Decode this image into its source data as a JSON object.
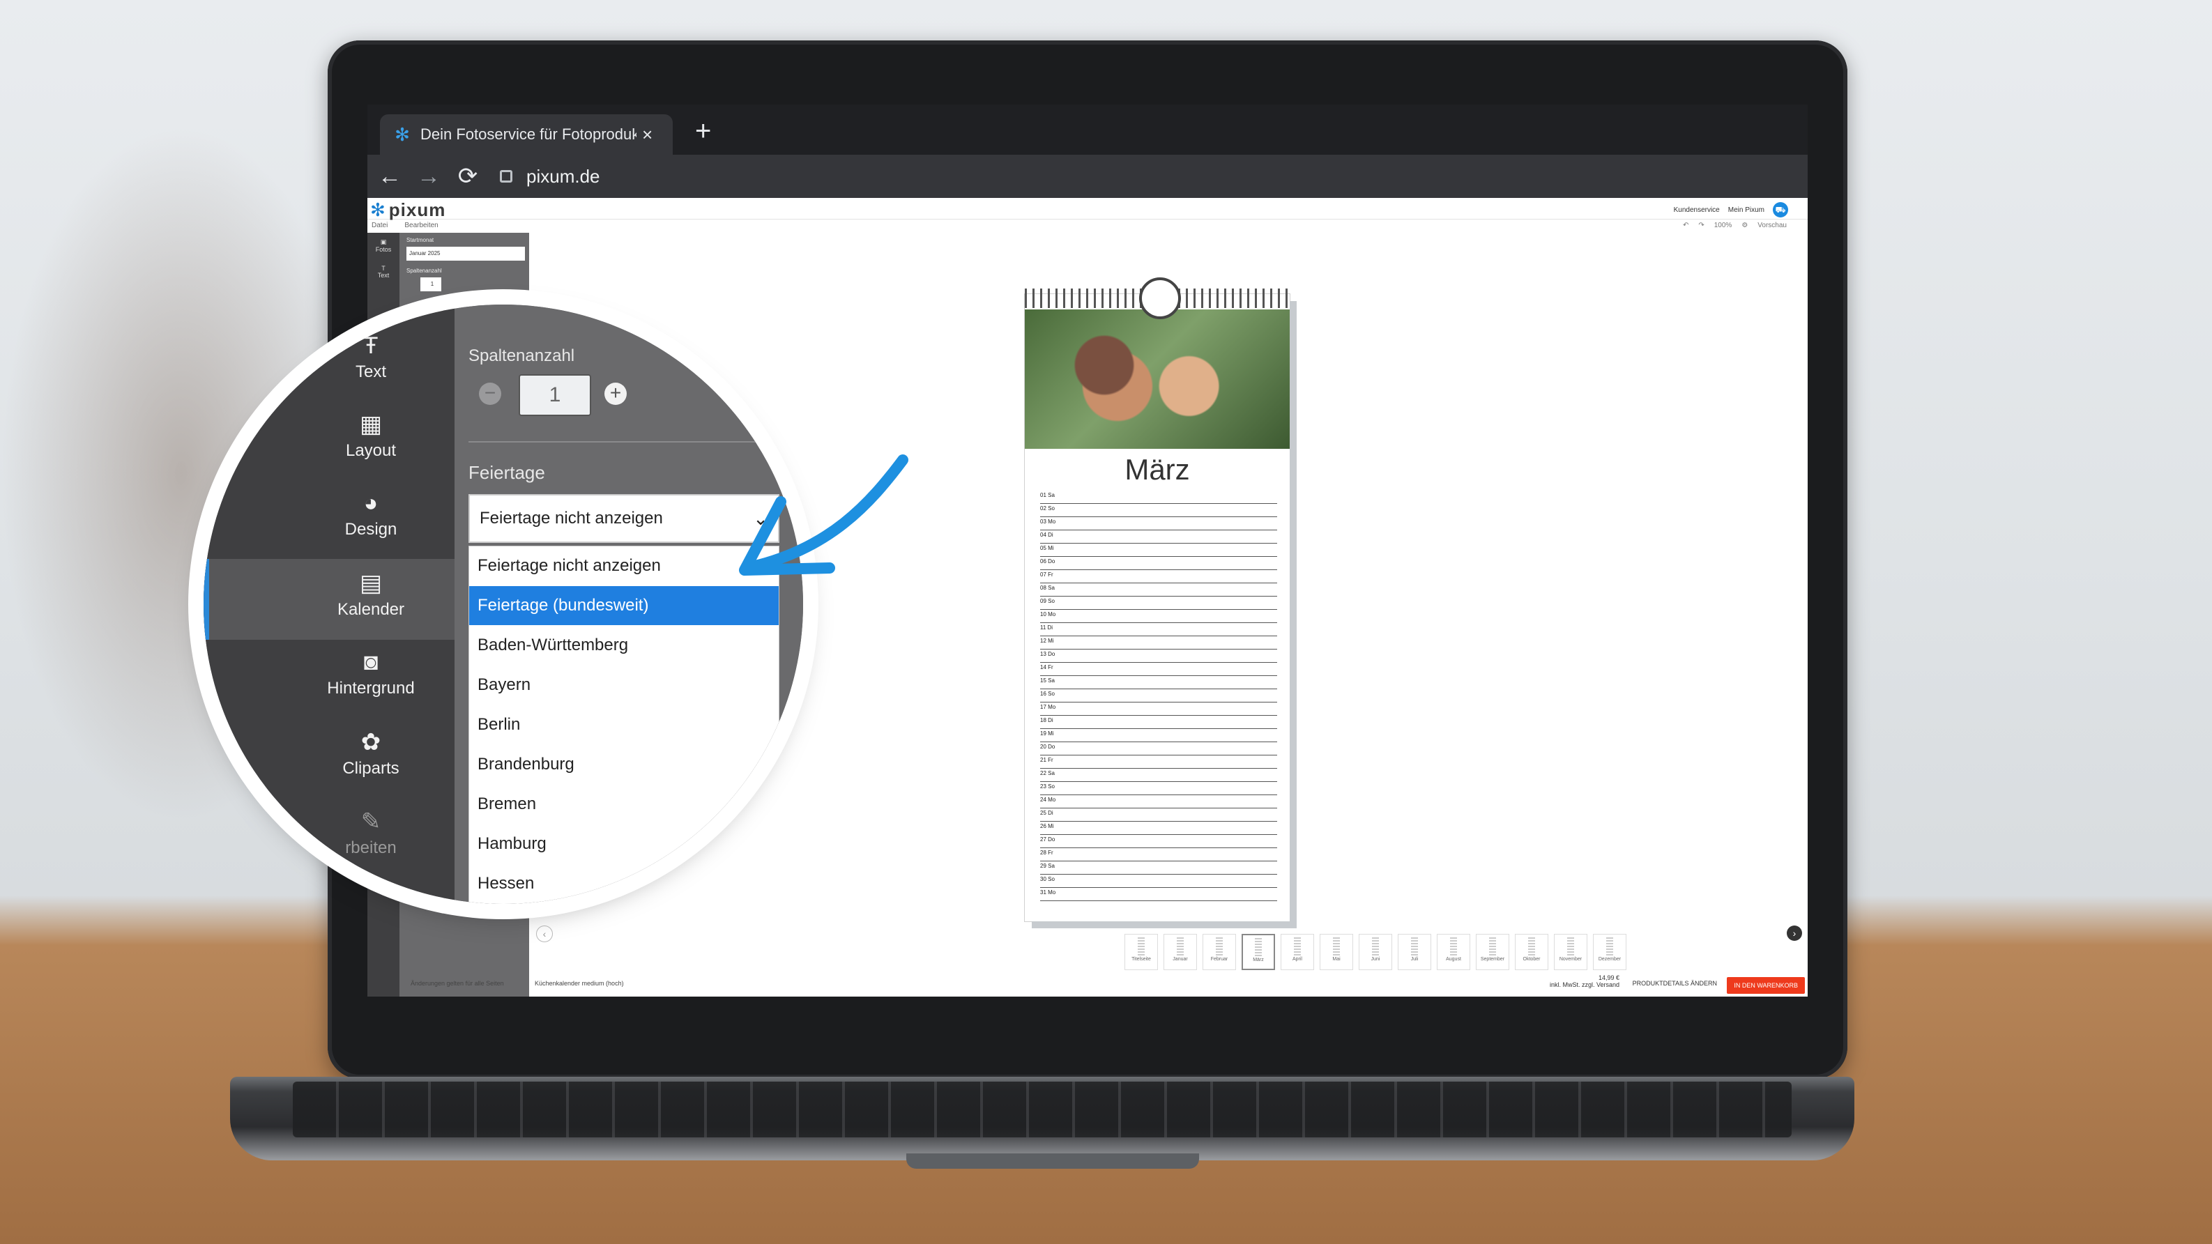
{
  "browser": {
    "tab_title": "Dein Fotoservice für Fotoprodukte",
    "tab_close": "×",
    "new_tab": "+",
    "url": "pixum.de",
    "back": "←",
    "forward": "→",
    "reload": "⟳"
  },
  "app": {
    "logo": "pixum",
    "toplinks": [
      "Kundenservice",
      "Mein Pixum"
    ],
    "menu": [
      "Datei",
      "Bearbeiten"
    ],
    "tools": [
      "100%",
      "Vorschau"
    ],
    "left_mini": {
      "items": [
        "Fotos",
        "Text"
      ],
      "start_label": "Startmonat",
      "start_value": "Januar 2025",
      "cols_label": "Spaltenanzahl",
      "cols_value": "1"
    },
    "footer_note": "Änderungen gelten für alle Seiten",
    "product_name": "Küchenkalender medium (hoch)",
    "price": "14,99 €",
    "price_note": "inkl. MwSt. zzgl. Versand",
    "product_details": "PRODUKTDETAILS ÄNDERN",
    "cart_button": "IN DEN WARENKORB",
    "filmstrip": [
      "Titelseite",
      "Januar",
      "Februar",
      "März",
      "April",
      "Mai",
      "Juni",
      "Juli",
      "August",
      "September",
      "Oktober",
      "November",
      "Dezember"
    ],
    "filmstrip_active": "März"
  },
  "calendar": {
    "month": "März",
    "days": [
      "01 Sa",
      "02 So",
      "03 Mo",
      "04 Di",
      "05 Mi",
      "06 Do",
      "07 Fr",
      "08 Sa",
      "09 So",
      "10 Mo",
      "11 Di",
      "12 Mi",
      "13 Do",
      "14 Fr",
      "15 Sa",
      "16 So",
      "17 Mo",
      "18 Di",
      "19 Mi",
      "20 Do",
      "21 Fr",
      "22 Sa",
      "23 So",
      "24 Mo",
      "25 Di",
      "26 Mi",
      "27 Do",
      "28 Fr",
      "29 Sa",
      "30 So",
      "31 Mo"
    ]
  },
  "magnifier": {
    "nav": [
      {
        "label": "Text",
        "icon": "text-icon"
      },
      {
        "label": "Layout",
        "icon": "layout-icon"
      },
      {
        "label": "Design",
        "icon": "palette-icon"
      },
      {
        "label": "Kalender",
        "icon": "calendar-icon"
      },
      {
        "label": "Hintergrund",
        "icon": "background-icon"
      },
      {
        "label": "Cliparts",
        "icon": "clipart-icon"
      },
      {
        "label": "rbeiten",
        "icon": "pencil-icon"
      }
    ],
    "active_nav": "Kalender",
    "columns_label": "Spaltenanzahl",
    "columns_value": "1",
    "holidays_label": "Feiertage",
    "holidays_selected": "Feiertage nicht anzeigen",
    "options": [
      "Feiertage nicht anzeigen",
      "Feiertage (bundesweit)",
      "Baden-Württemberg",
      "Bayern",
      "Berlin",
      "Brandenburg",
      "Bremen",
      "Hamburg",
      "Hessen"
    ],
    "highlighted_option": "Feiertage (bundesweit)"
  },
  "colors": {
    "accent": "#1f7fe0",
    "cta": "#ee3a1c",
    "panel": "#6a6a6c",
    "rail": "#3f3f41",
    "arrow": "#1e90e0"
  }
}
